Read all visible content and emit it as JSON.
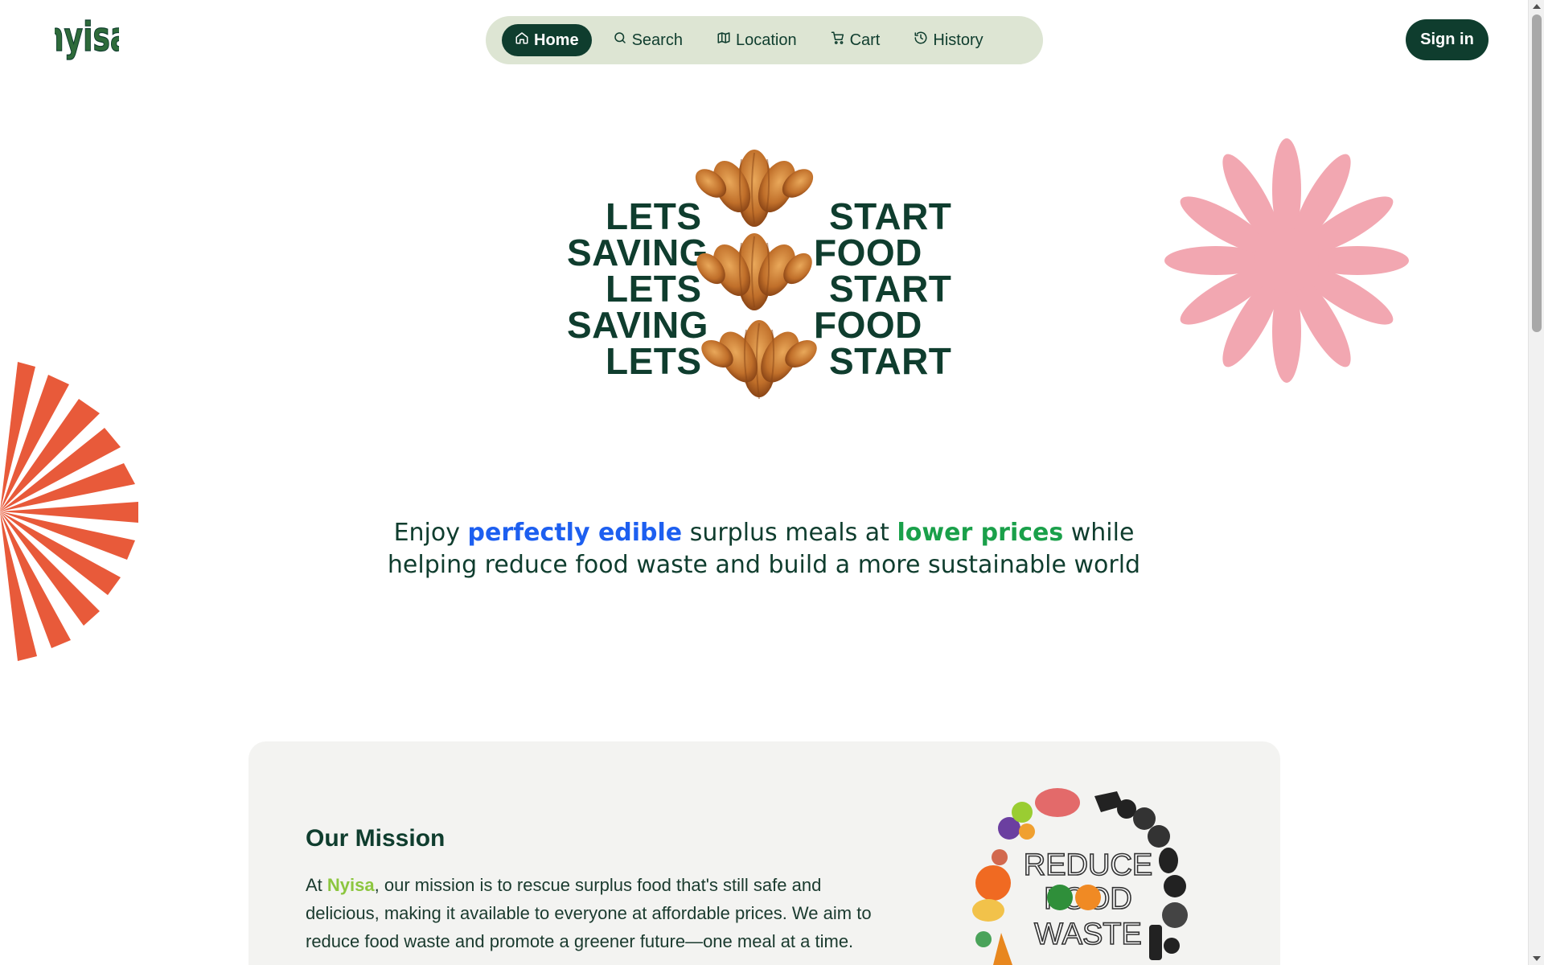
{
  "header": {
    "logo_text": "nyisa",
    "nav": [
      {
        "label": "Home",
        "icon": "home-icon",
        "active": true
      },
      {
        "label": "Search",
        "icon": "search-icon",
        "active": false
      },
      {
        "label": "Location",
        "icon": "map-icon",
        "active": false
      },
      {
        "label": "Cart",
        "icon": "cart-icon",
        "active": false
      },
      {
        "label": "History",
        "icon": "history-icon",
        "active": false
      }
    ],
    "signin_label": "Sign in"
  },
  "hero": {
    "left_words": [
      "LETS",
      "SAVING",
      "LETS",
      "SAVING",
      "LETS"
    ],
    "right_words": [
      "START",
      "FOOD",
      "START",
      "FOOD",
      "START"
    ]
  },
  "tagline": {
    "part1": "Enjoy ",
    "highlight1": "perfectly edible",
    "part2": " surplus meals at ",
    "highlight2": "lower prices",
    "part3": " while helping reduce food waste and build a more sustainable world"
  },
  "mission": {
    "title": "Our Mission",
    "text_prefix": "At ",
    "brand": "Nyisa",
    "text_body": ", our mission is to rescue surplus food that's still safe and delicious, making it available to everyone at affordable prices. We aim to reduce food waste and promote a greener future—one meal at a time.",
    "image_text": [
      "REDUCE",
      "FOOD",
      "WASTE"
    ]
  },
  "colors": {
    "primary": "#0f3d2e",
    "nav_bg": "#dde5d3",
    "highlight_blue": "#1d5ff0",
    "highlight_green": "#1aa04a",
    "brand_green": "#8cc63f",
    "flower_pink": "#f2a7b1",
    "burst_orange": "#e85a3a"
  }
}
